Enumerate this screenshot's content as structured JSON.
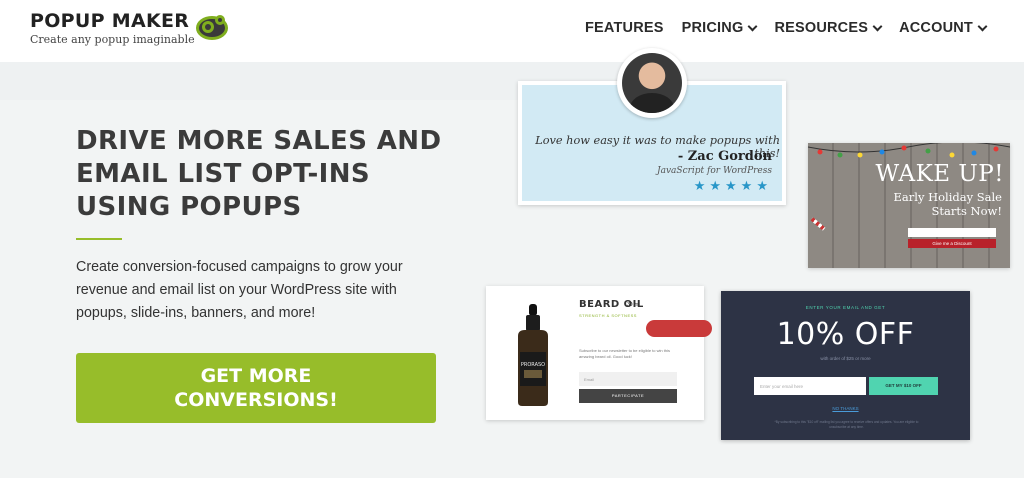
{
  "brand": {
    "name": "POPUP MAKER",
    "tagline": "Create any popup imaginable",
    "logo_icon": "popup-maker-gear-logo"
  },
  "nav": {
    "items": [
      {
        "label": "FEATURES",
        "has_dropdown": false
      },
      {
        "label": "PRICING",
        "has_dropdown": true
      },
      {
        "label": "RESOURCES",
        "has_dropdown": true
      },
      {
        "label": "ACCOUNT",
        "has_dropdown": true
      }
    ]
  },
  "hero": {
    "title": "DRIVE MORE SALES AND EMAIL LIST OPT-INS USING POPUPS",
    "subtitle": "Create conversion-focused campaigns to grow your revenue and email list on your WordPress site with popups, slide-ins, banners, and more!",
    "cta_label": "GET MORE CONVERSIONS!"
  },
  "previews": {
    "testimonial": {
      "quote": "Love how easy it was to make popups with this!",
      "author": "- Zac Gordon",
      "role": "JavaScript for WordPress",
      "stars": "★★★★★"
    },
    "holiday": {
      "title": "WAKE UP!",
      "subtitle_line1": "Early Holiday Sale",
      "subtitle_line2": "Starts Now!",
      "button": "Give me a Discount"
    },
    "beard": {
      "title": "BEARD OIL",
      "size": "30 ml",
      "tagline": "STRENGTH & SOFTNESS",
      "description": "Subscribe to our newsletter to be eligible to win this amazing beard oil. Good luck!",
      "input_placeholder": "Email",
      "button": "PARTECIPATE",
      "bottle_label": "PRORASO"
    },
    "offer": {
      "top": "ENTER YOUR EMAIL AND GET",
      "headline": "10% OFF",
      "small": "with order of $25 or more",
      "input_placeholder": "Enter your email here",
      "button": "GET MY $10 OFF",
      "link": "NO THANKS",
      "fine_print": "*By subscribing to this \"$10 off\" mailing list you agree to receive offers and updates. You are eligible to unsubscribe at any time."
    }
  },
  "colors": {
    "accent_green": "#97bd2a",
    "star_blue": "#2896c8",
    "offer_bg": "#2d3345",
    "offer_teal": "#50d4b0",
    "holiday_red": "#b8212a"
  }
}
